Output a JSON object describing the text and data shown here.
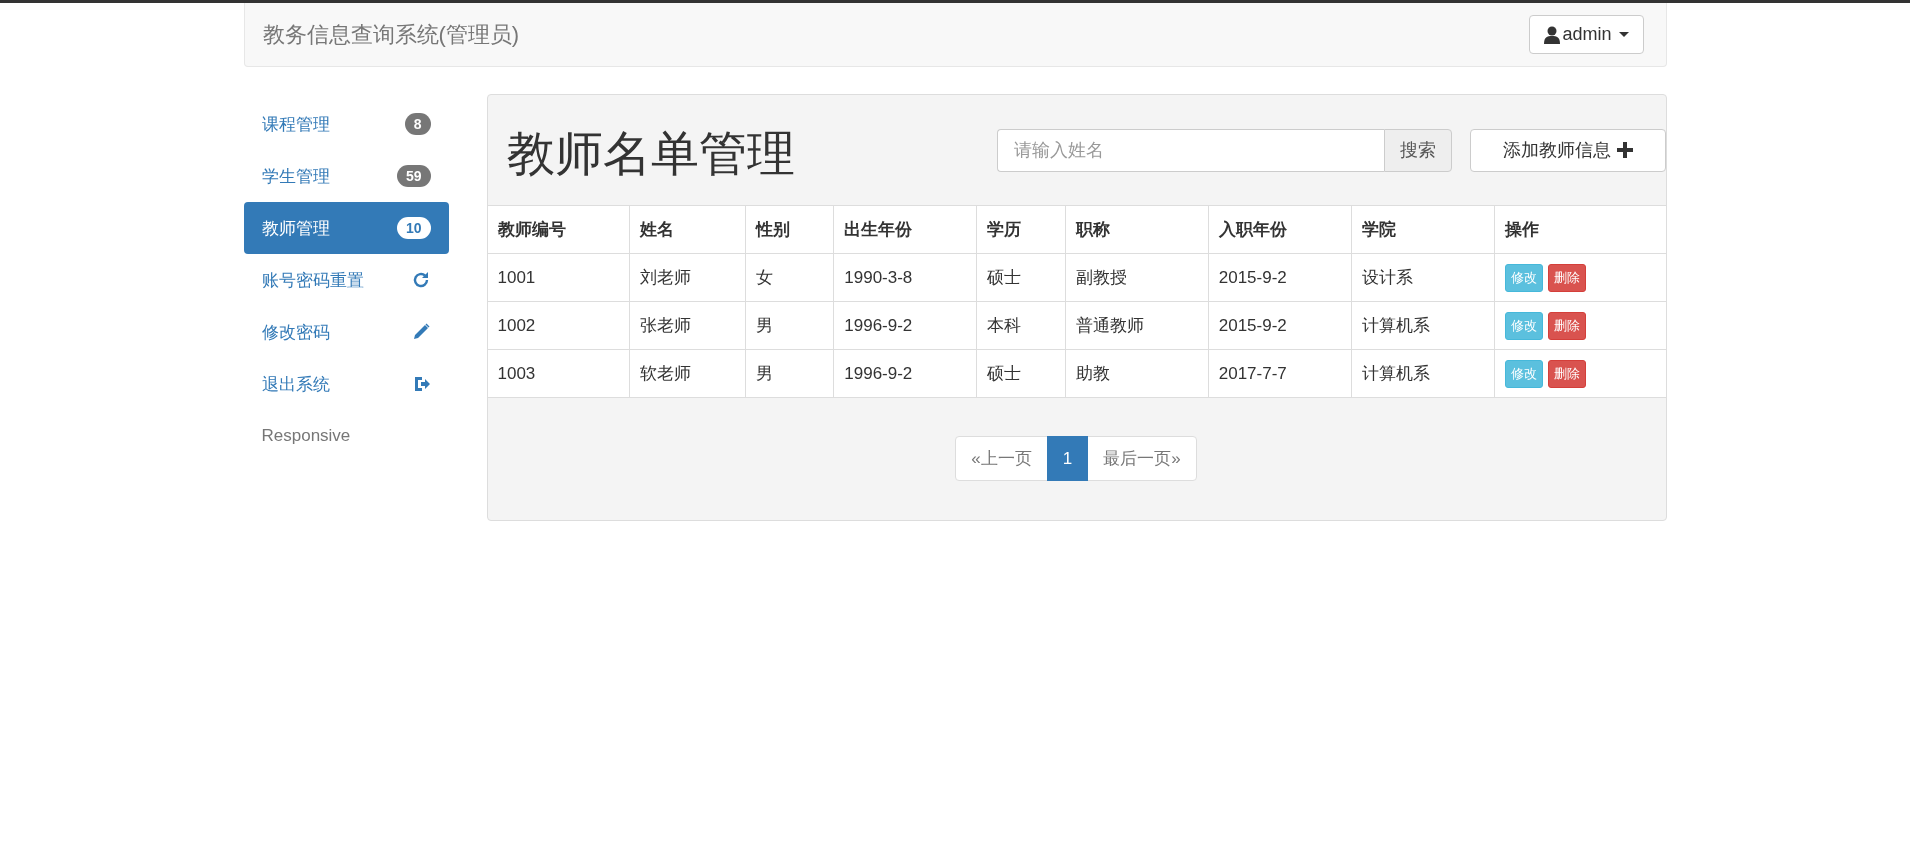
{
  "navbar": {
    "brand": "教务信息查询系统(管理员)",
    "user_menu": "admin"
  },
  "sidebar": {
    "items": [
      {
        "label": "课程管理",
        "kind": "badge",
        "badge": "8",
        "selected": false
      },
      {
        "label": "学生管理",
        "kind": "badge",
        "badge": "59",
        "selected": false
      },
      {
        "label": "教师管理",
        "kind": "badge",
        "badge": "10",
        "selected": true
      },
      {
        "label": "账号密码重置",
        "kind": "icon",
        "selected": false
      },
      {
        "label": "修改密码",
        "kind": "icon",
        "selected": false
      },
      {
        "label": "退出系统",
        "kind": "icon",
        "selected": false
      },
      {
        "label": "Responsive",
        "kind": "plain",
        "selected": false
      }
    ]
  },
  "panel": {
    "title": "教师名单管理",
    "search": {
      "placeholder": "请输入姓名",
      "button": "搜索"
    },
    "add_button": "添加教师信息",
    "table": {
      "columns": [
        "教师编号",
        "姓名",
        "性别",
        "出生年份",
        "学历",
        "职称",
        "入职年份",
        "学院",
        "操作"
      ],
      "rows": [
        {
          "cells": [
            "1001",
            "刘老师",
            "女",
            "1990-3-8",
            "硕士",
            "副教授",
            "2015-9-2",
            "设计系"
          ],
          "actions": [
            {
              "label": "修改",
              "kind": "edit"
            },
            {
              "label": "删除",
              "kind": "delete"
            }
          ]
        },
        {
          "cells": [
            "1002",
            "张老师",
            "男",
            "1996-9-2",
            "本科",
            "普通教师",
            "2015-9-2",
            "计算机系"
          ],
          "actions": [
            {
              "label": "修改",
              "kind": "edit"
            },
            {
              "label": "删除",
              "kind": "delete"
            }
          ]
        },
        {
          "cells": [
            "1003",
            "软老师",
            "男",
            "1996-9-2",
            "硕士",
            "助教",
            "2017-7-7",
            "计算机系"
          ],
          "actions": [
            {
              "label": "修改",
              "kind": "edit"
            },
            {
              "label": "删除",
              "kind": "delete"
            }
          ]
        }
      ]
    },
    "pagination": [
      {
        "label": "«上一页",
        "selected": false
      },
      {
        "label": "1",
        "selected": true
      },
      {
        "label": "最后一页»",
        "selected": false
      }
    ]
  }
}
